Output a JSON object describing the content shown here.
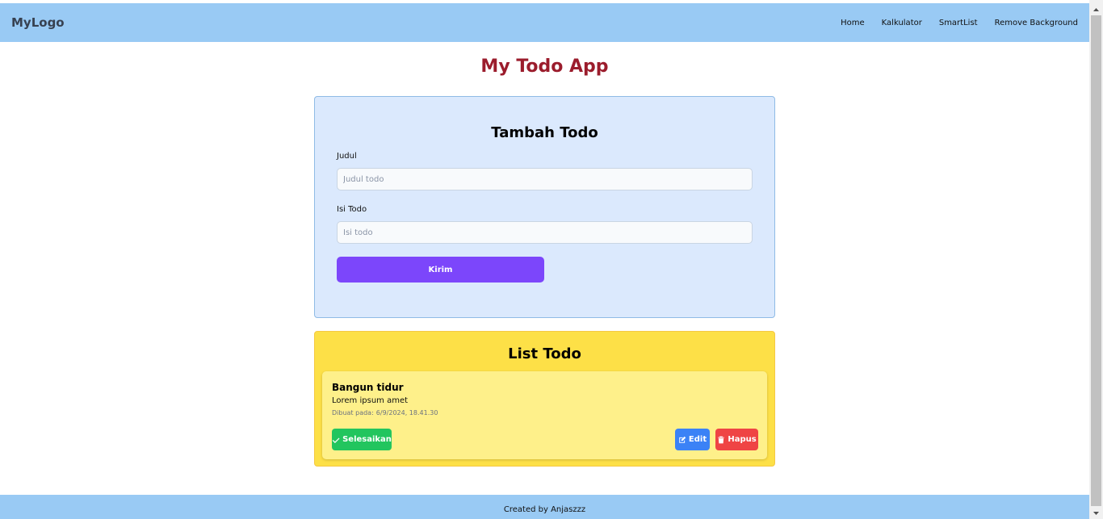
{
  "nav": {
    "logo": "MyLogo",
    "links": [
      "Home",
      "Kalkulator",
      "SmartList",
      "Remove Background"
    ]
  },
  "page": {
    "title": "My Todo App"
  },
  "form": {
    "title": "Tambah Todo",
    "judul_label": "Judul",
    "judul_placeholder": "Judul todo",
    "isi_label": "Isi Todo",
    "isi_placeholder": "Isi todo",
    "submit_label": "Kirim"
  },
  "list": {
    "title": "List Todo",
    "items": [
      {
        "title": "Bangun tidur",
        "body": "Lorem ipsum amet",
        "created_label": "Dibuat pada:",
        "created_value": "6/9/2024, 18.41.30",
        "done_label": "Selesaikan",
        "edit_label": "Edit",
        "delete_label": "Hapus"
      }
    ]
  },
  "footer": {
    "text": "Created by Anjaszzz"
  },
  "colors": {
    "navbar": "#99caf4",
    "title": "#9b1c2c",
    "form_bg": "#dbe9fd",
    "submit": "#7c46fb",
    "list_bg": "#fde047",
    "item_bg": "#fef08a",
    "done": "#22c55e",
    "edit": "#3b82f6",
    "delete": "#ef4444"
  },
  "icons": {
    "done": "check-icon",
    "edit": "edit-icon",
    "delete": "trash-icon",
    "scroll_up": "scroll-up-arrow-icon",
    "scroll_down": "scroll-down-arrow-icon"
  }
}
